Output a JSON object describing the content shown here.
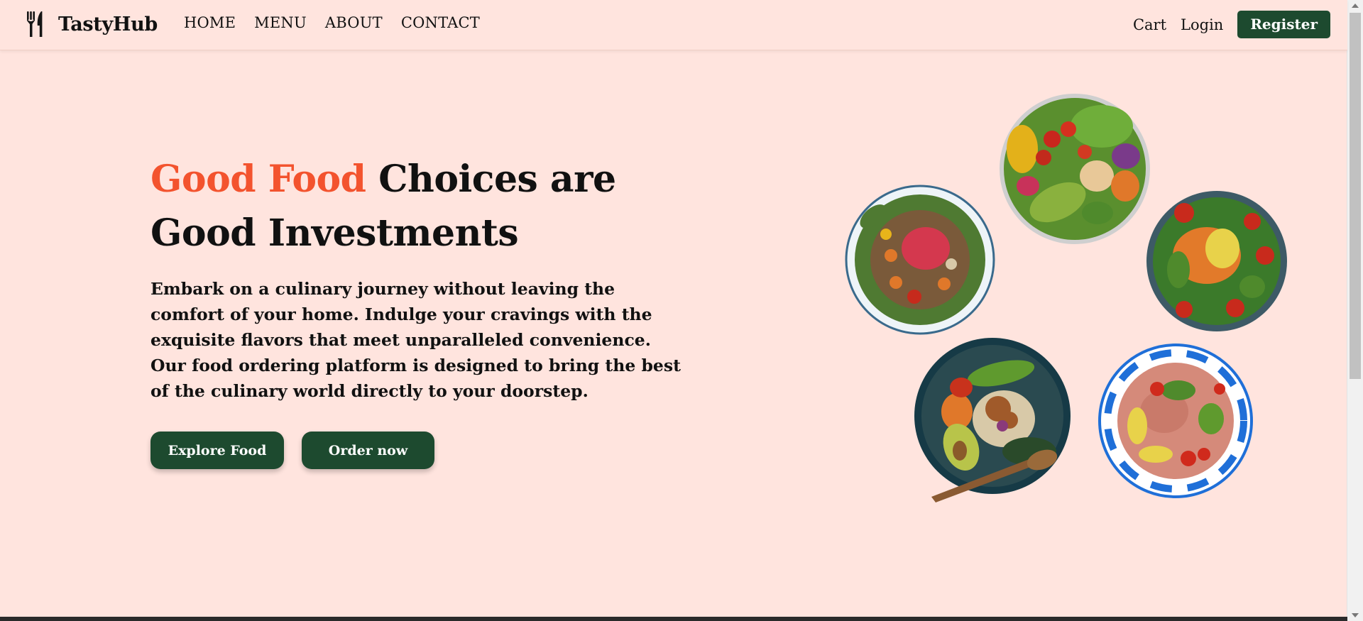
{
  "brand": {
    "name": "TastyHub",
    "logo_icon": "fork-knife-icon"
  },
  "nav": {
    "links": [
      {
        "label": "HOME"
      },
      {
        "label": "MENU"
      },
      {
        "label": "ABOUT"
      },
      {
        "label": "CONTACT"
      }
    ],
    "cart_label": "Cart",
    "login_label": "Login",
    "register_label": "Register"
  },
  "hero": {
    "title_accent": "Good Food",
    "title_rest": " Choices are Good Investments",
    "description": "Embark on a culinary journey without leaving the comfort of your home. Indulge your cravings with the exquisite flavors that meet unparalleled convenience. Our food ordering platform is designed to bring the best of the culinary world directly to your doorstep.",
    "explore_label": "Explore Food",
    "order_label": "Order now"
  },
  "colors": {
    "background": "#ffe4de",
    "accent": "#f3532e",
    "button": "#1d4a2f"
  }
}
